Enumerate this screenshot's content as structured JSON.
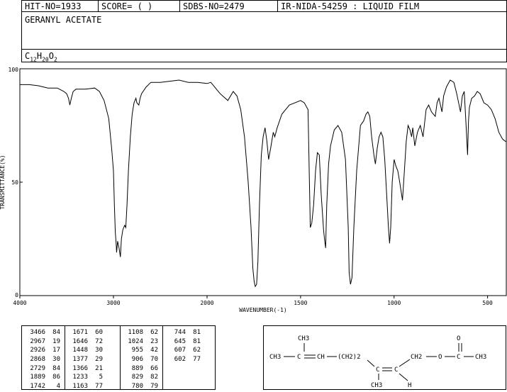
{
  "header": {
    "hit_no": "HIT-NO=1933",
    "score": "SCORE=  (  )",
    "sdbs_no": "SDBS-NO=2479",
    "ir_code": "IR-NIDA-54259 : LIQUID FILM",
    "compound": "GERANYL ACETATE",
    "formula_c": "C",
    "formula_c_sub": "12",
    "formula_h": "H",
    "formula_h_sub": "20",
    "formula_o": "O",
    "formula_o_sub": "2"
  },
  "chart_data": {
    "type": "line",
    "title": "",
    "xlabel": "WAVENUMBER(-1)",
    "ylabel": "TRANSMITTANCE(%)",
    "xlim": [
      4000,
      400
    ],
    "ylim": [
      0,
      100
    ],
    "x_ticks": [
      "4000",
      "3000",
      "2000",
      "1500",
      "1000",
      "500"
    ],
    "y_ticks": [
      "100",
      "50",
      "0"
    ],
    "grid": false,
    "series": [
      {
        "name": "",
        "points": [
          [
            4000,
            93
          ],
          [
            3900,
            93
          ],
          [
            3800,
            92.5
          ],
          [
            3700,
            91.5
          ],
          [
            3600,
            91.5
          ],
          [
            3530,
            90
          ],
          [
            3500,
            89
          ],
          [
            3480,
            87
          ],
          [
            3466,
            84
          ],
          [
            3450,
            87
          ],
          [
            3430,
            90
          ],
          [
            3400,
            91
          ],
          [
            3300,
            91
          ],
          [
            3200,
            91.5
          ],
          [
            3150,
            90
          ],
          [
            3100,
            86
          ],
          [
            3050,
            78
          ],
          [
            3020,
            65
          ],
          [
            3000,
            55
          ],
          [
            2990,
            40
          ],
          [
            2980,
            28
          ],
          [
            2970,
            22
          ],
          [
            2967,
            19
          ],
          [
            2955,
            24
          ],
          [
            2940,
            21
          ],
          [
            2926,
            17
          ],
          [
            2915,
            25
          ],
          [
            2900,
            29
          ],
          [
            2880,
            31
          ],
          [
            2868,
            30
          ],
          [
            2855,
            40
          ],
          [
            2840,
            55
          ],
          [
            2820,
            70
          ],
          [
            2800,
            80
          ],
          [
            2780,
            85
          ],
          [
            2760,
            87
          ],
          [
            2750,
            85
          ],
          [
            2729,
            84
          ],
          [
            2715,
            87
          ],
          [
            2700,
            89
          ],
          [
            2650,
            92
          ],
          [
            2600,
            94
          ],
          [
            2500,
            94
          ],
          [
            2400,
            94.5
          ],
          [
            2300,
            95
          ],
          [
            2200,
            94
          ],
          [
            2100,
            94
          ],
          [
            2000,
            93.5
          ],
          [
            1980,
            94
          ],
          [
            1930,
            89
          ],
          [
            1889,
            86
          ],
          [
            1860,
            90
          ],
          [
            1840,
            88
          ],
          [
            1820,
            82
          ],
          [
            1800,
            70
          ],
          [
            1780,
            50
          ],
          [
            1765,
            30
          ],
          [
            1755,
            12
          ],
          [
            1748,
            6
          ],
          [
            1742,
            4
          ],
          [
            1735,
            5
          ],
          [
            1728,
            15
          ],
          [
            1720,
            40
          ],
          [
            1710,
            62
          ],
          [
            1700,
            70
          ],
          [
            1690,
            74
          ],
          [
            1680,
            68
          ],
          [
            1671,
            60
          ],
          [
            1660,
            65
          ],
          [
            1650,
            70
          ],
          [
            1646,
            72
          ],
          [
            1638,
            70
          ],
          [
            1625,
            74
          ],
          [
            1600,
            80
          ],
          [
            1560,
            84
          ],
          [
            1500,
            86
          ],
          [
            1480,
            85
          ],
          [
            1460,
            82
          ],
          [
            1448,
            30
          ],
          [
            1440,
            32
          ],
          [
            1430,
            40
          ],
          [
            1420,
            55
          ],
          [
            1410,
            63
          ],
          [
            1400,
            62
          ],
          [
            1390,
            45
          ],
          [
            1377,
            29
          ],
          [
            1372,
            25
          ],
          [
            1366,
            21
          ],
          [
            1360,
            40
          ],
          [
            1350,
            58
          ],
          [
            1340,
            66
          ],
          [
            1320,
            73
          ],
          [
            1300,
            75
          ],
          [
            1280,
            72
          ],
          [
            1260,
            60
          ],
          [
            1245,
            30
          ],
          [
            1240,
            10
          ],
          [
            1233,
            5
          ],
          [
            1225,
            8
          ],
          [
            1215,
            30
          ],
          [
            1200,
            55
          ],
          [
            1180,
            75
          ],
          [
            1163,
            77
          ],
          [
            1150,
            80
          ],
          [
            1140,
            81
          ],
          [
            1130,
            79
          ],
          [
            1120,
            70
          ],
          [
            1108,
            62
          ],
          [
            1100,
            58
          ],
          [
            1090,
            65
          ],
          [
            1080,
            70
          ],
          [
            1070,
            72
          ],
          [
            1060,
            70
          ],
          [
            1050,
            60
          ],
          [
            1040,
            45
          ],
          [
            1030,
            30
          ],
          [
            1024,
            23
          ],
          [
            1018,
            30
          ],
          [
            1010,
            50
          ],
          [
            1000,
            60
          ],
          [
            990,
            57
          ],
          [
            980,
            55
          ],
          [
            970,
            50
          ],
          [
            955,
            42
          ],
          [
            945,
            55
          ],
          [
            935,
            68
          ],
          [
            925,
            75
          ],
          [
            915,
            73
          ],
          [
            906,
            70
          ],
          [
            900,
            74
          ],
          [
            889,
            66
          ],
          [
            875,
            72
          ],
          [
            860,
            75
          ],
          [
            845,
            70
          ],
          [
            829,
            82
          ],
          [
            815,
            84
          ],
          [
            800,
            81
          ],
          [
            780,
            79
          ],
          [
            770,
            85
          ],
          [
            760,
            87
          ],
          [
            744,
            81
          ],
          [
            735,
            88
          ],
          [
            720,
            92
          ],
          [
            700,
            95
          ],
          [
            680,
            94
          ],
          [
            665,
            89
          ],
          [
            645,
            81
          ],
          [
            635,
            88
          ],
          [
            625,
            90
          ],
          [
            615,
            75
          ],
          [
            607,
            62
          ],
          [
            602,
            77
          ],
          [
            597,
            83
          ],
          [
            585,
            87
          ],
          [
            570,
            88
          ],
          [
            555,
            90
          ],
          [
            540,
            89
          ],
          [
            520,
            85
          ],
          [
            500,
            84
          ],
          [
            480,
            82
          ],
          [
            460,
            78
          ],
          [
            440,
            72
          ],
          [
            420,
            69
          ],
          [
            405,
            68
          ],
          [
            400,
            68
          ]
        ]
      }
    ]
  },
  "peak_table": {
    "columns": [
      [
        [
          "3466",
          "84"
        ],
        [
          "2967",
          "19"
        ],
        [
          "2926",
          "17"
        ],
        [
          "2868",
          "30"
        ],
        [
          "2729",
          "84"
        ],
        [
          "1889",
          "86"
        ],
        [
          "1742",
          "4"
        ]
      ],
      [
        [
          "1671",
          "60"
        ],
        [
          "1646",
          "72"
        ],
        [
          "1448",
          "30"
        ],
        [
          "1377",
          "29"
        ],
        [
          "1366",
          "21"
        ],
        [
          "1233",
          "5"
        ],
        [
          "1163",
          "77"
        ]
      ],
      [
        [
          "1108",
          "62"
        ],
        [
          "1024",
          "23"
        ],
        [
          "955",
          "42"
        ],
        [
          "906",
          "70"
        ],
        [
          "889",
          "66"
        ],
        [
          "829",
          "82"
        ],
        [
          "780",
          "79"
        ]
      ],
      [
        [
          "744",
          "81"
        ],
        [
          "645",
          "81"
        ],
        [
          "607",
          "62"
        ],
        [
          "602",
          "77"
        ]
      ]
    ]
  },
  "structure": {
    "top_ch3": "CH3",
    "left_ch3": "CH3",
    "c1": "C",
    "ch": "CH",
    "ch2n": "(CH2)2",
    "c2": "C",
    "c3": "C",
    "h": "H",
    "bottom_ch3": "CH3",
    "ch2": "CH2",
    "o": "O",
    "o_top": "O",
    "c4": "C",
    "right_ch3": "CH3"
  }
}
